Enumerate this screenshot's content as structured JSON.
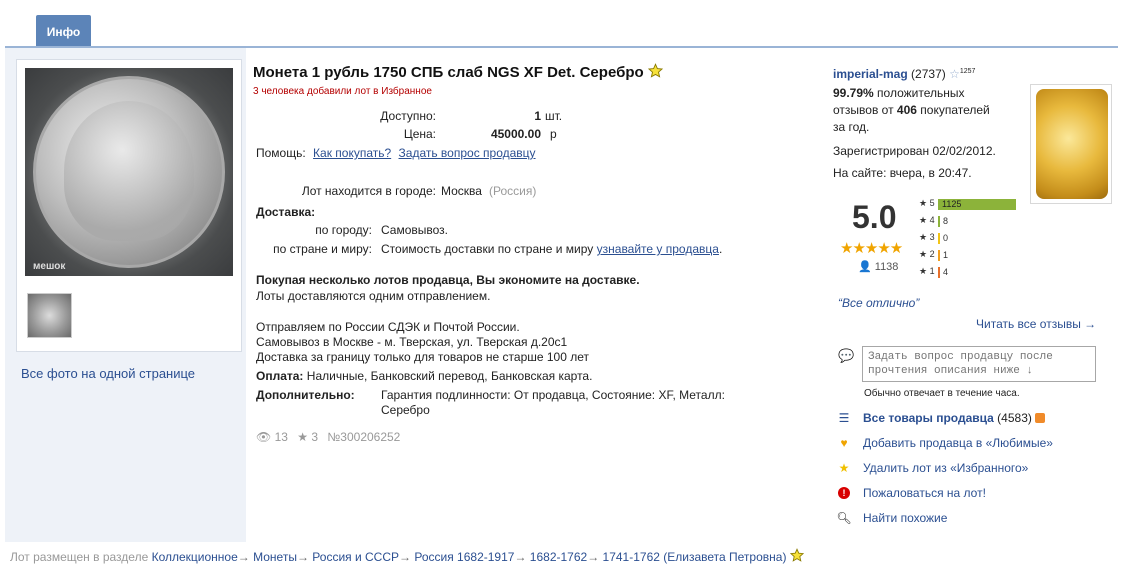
{
  "tabs": {
    "info": "Инфо"
  },
  "photos": {
    "watermark": "мешок",
    "all_photos": "Все фото на одной странице"
  },
  "lot": {
    "title": "Монета 1 рубль 1750 СПБ слаб NGS XF Det. Серебро",
    "fav_note": "3 человека добавили лот в Избранное",
    "available_label": "Доступно:",
    "available_value": "1",
    "available_unit": "шт.",
    "price_label": "Цена:",
    "price_value": "45000.00",
    "price_unit": "р",
    "help_label": "Помощь:",
    "help_link1": "Как покупать?",
    "help_link2": "Задать вопрос продавцу",
    "city_label": "Лот находится в городе:",
    "city_value": "Москва",
    "city_region": "(Россия)",
    "delivery_label": "Доставка:",
    "delivery_city_label": "по городу:",
    "delivery_city_value": "Самовывоз.",
    "delivery_world_label": "по стране и миру:",
    "delivery_world_value": "Стоимость доставки по стране и миру",
    "delivery_world_link": "узнавайте у продавца",
    "savings_bold": "Покупая несколько лотов продавца, Вы экономите на доставке.",
    "savings_text": "Лоты доставляются одним отправлением.",
    "ship_line1": "Отправляем по России СДЭК и Почтой России.",
    "ship_line2": "Самовывоз в Москве - м. Тверская, ул. Тверская д.20с1",
    "ship_line3": "Доставка за границу только для товаров не старше 100 лет",
    "payment_label": "Оплата:",
    "payment_value": "Наличные, Банковский перевод, Банковская карта.",
    "extra_label": "Дополнительно:",
    "extra_value1": "Гарантия подлинности: От продавца, Состояние: XF, Металл:",
    "extra_value2": "Серебро",
    "views": "13",
    "stars": "3",
    "lot_number": "№300206252"
  },
  "seller": {
    "name": "imperial-mag",
    "count": "(2737)",
    "star_count": "1257",
    "positive_pct": "99.79%",
    "positive_text1": "положительных",
    "positive_text2a": "отзывов от",
    "buyers": "406",
    "positive_text2b": "покупателей",
    "positive_text3": "за год.",
    "registered": "Зарегистрирован 02/02/2012.",
    "online": "На сайте: вчера, в 20:47.",
    "rating": "5.0",
    "rating_stars": "★★★★★",
    "rating_count": "1138",
    "bars": [
      {
        "star": "5",
        "value": "1125",
        "fraction": 1.0,
        "color": "#8cb33a"
      },
      {
        "star": "4",
        "value": "8",
        "fraction": 0.01,
        "color": "#8cb33a"
      },
      {
        "star": "3",
        "value": "0",
        "fraction": 0.0,
        "color": "#f2c417"
      },
      {
        "star": "2",
        "value": "1",
        "fraction": 0.005,
        "color": "#f0a020"
      },
      {
        "star": "1",
        "value": "4",
        "fraction": 0.005,
        "color": "#e8702a"
      }
    ],
    "quote": "“Все отлично”",
    "read_all": "Читать все отзывы →",
    "ask_placeholder": "Задать вопрос продавцу после прочтения описания ниже ↓",
    "ask_note": "Обычно отвечает в течение часа.",
    "menu": {
      "all_goods": "Все товары продавца",
      "all_goods_count": "(4583)",
      "add_fav": "Добавить продавца в «Любимые»",
      "remove_lot": "Удалить лот из «Избранного»",
      "complain": "Пожаловаться на лот!",
      "similar": "Найти похожие"
    },
    "colors": {
      "link": "#2b4f91",
      "accent_tab": "#5c84b8",
      "alert_red": "#b40000"
    }
  },
  "breadcrumb": {
    "prefix": "Лот размещен в разделе",
    "items": [
      "Коллекционное",
      "Монеты",
      "Россия и СССР",
      "Россия 1682-1917",
      "1682-1762",
      "1741-1762 (Елизавета Петровна)"
    ],
    "arrow": "→"
  }
}
